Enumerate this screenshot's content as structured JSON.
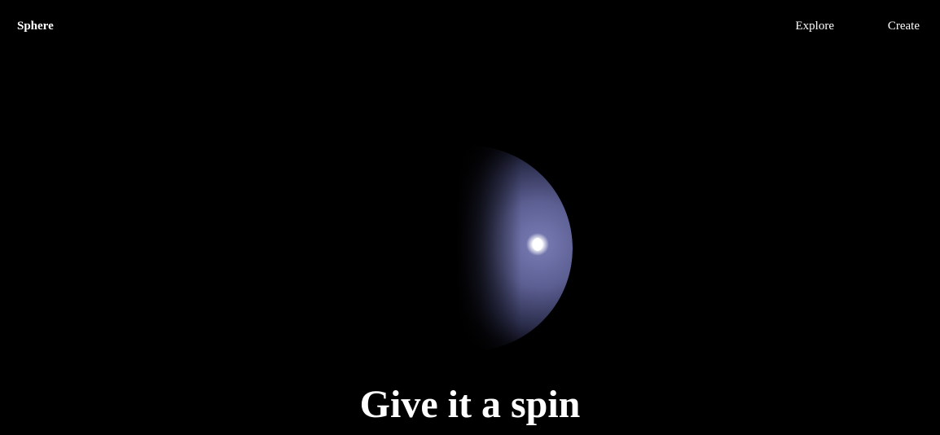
{
  "header": {
    "brand": "Sphere",
    "nav": [
      {
        "label": "Explore"
      },
      {
        "label": "Create"
      }
    ]
  },
  "hero": {
    "headline": "Give it a spin"
  },
  "colors": {
    "background": "#000000",
    "text": "#ffffff",
    "sphere_lit": "#6f72a8",
    "sphere_shadow": "#000000",
    "highlight": "#ffffff"
  }
}
